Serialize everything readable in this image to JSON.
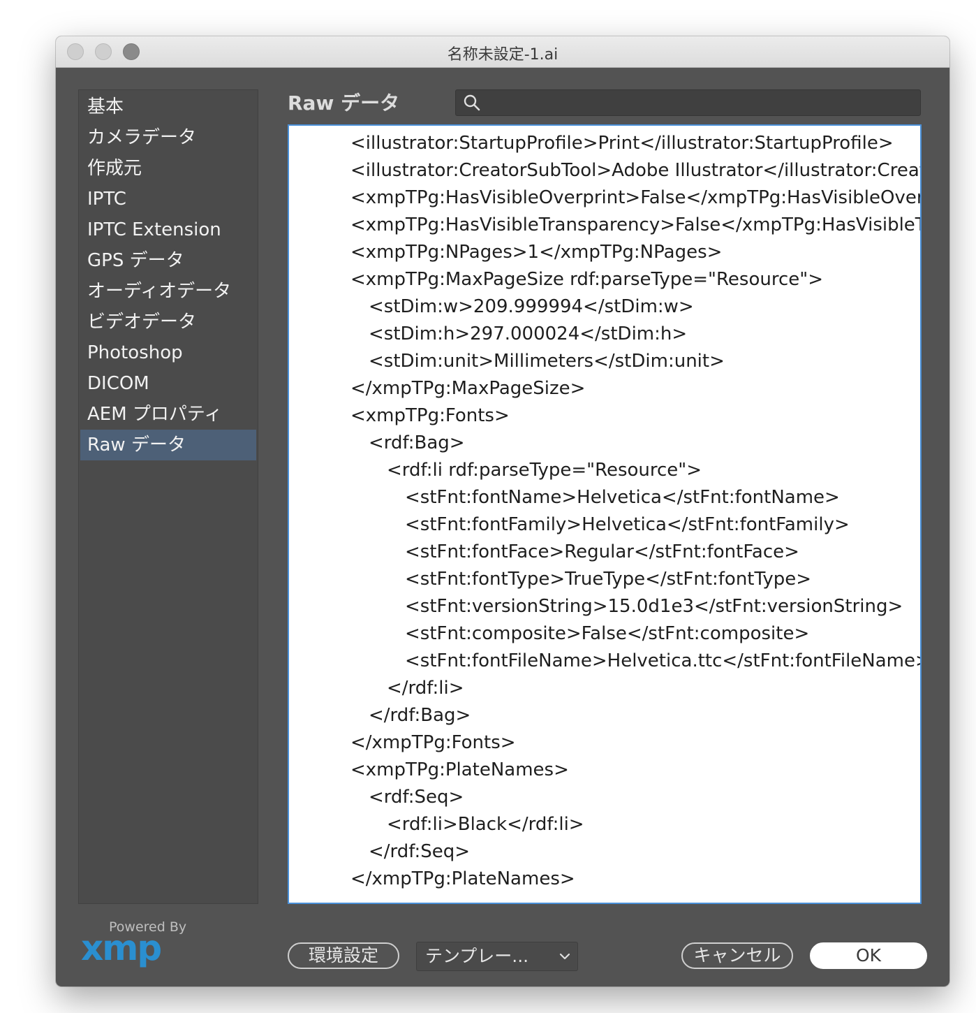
{
  "window": {
    "title": "名称未設定-1.ai"
  },
  "sidebar": {
    "items": [
      {
        "label": "基本"
      },
      {
        "label": "カメラデータ"
      },
      {
        "label": "作成元"
      },
      {
        "label": "IPTC"
      },
      {
        "label": "IPTC Extension"
      },
      {
        "label": "GPS データ"
      },
      {
        "label": "オーディオデータ"
      },
      {
        "label": "ビデオデータ"
      },
      {
        "label": "Photoshop"
      },
      {
        "label": "DICOM"
      },
      {
        "label": "AEM プロパティ"
      },
      {
        "label": "Raw データ",
        "selected": true
      }
    ]
  },
  "main": {
    "panel_title": "Raw データ",
    "search": {
      "value": "",
      "placeholder": ""
    },
    "raw_lines": [
      {
        "indent": 0,
        "text": "<illustrator:StartupProfile>Print</illustrator:StartupProfile>"
      },
      {
        "indent": 0,
        "text": "<illustrator:CreatorSubTool>Adobe Illustrator</illustrator:Creato"
      },
      {
        "indent": 0,
        "text": "<xmpTPg:HasVisibleOverprint>False</xmpTPg:HasVisibleOverpr"
      },
      {
        "indent": 0,
        "text": "<xmpTPg:HasVisibleTransparency>False</xmpTPg:HasVisibleTra"
      },
      {
        "indent": 0,
        "text": "<xmpTPg:NPages>1</xmpTPg:NPages>"
      },
      {
        "indent": 0,
        "text": "<xmpTPg:MaxPageSize rdf:parseType=\"Resource\">"
      },
      {
        "indent": 1,
        "text": "<stDim:w>209.999994</stDim:w>"
      },
      {
        "indent": 1,
        "text": "<stDim:h>297.000024</stDim:h>"
      },
      {
        "indent": 1,
        "text": "<stDim:unit>Millimeters</stDim:unit>"
      },
      {
        "indent": 0,
        "text": "</xmpTPg:MaxPageSize>"
      },
      {
        "indent": 0,
        "text": "<xmpTPg:Fonts>"
      },
      {
        "indent": 1,
        "text": "<rdf:Bag>"
      },
      {
        "indent": 2,
        "text": "<rdf:li rdf:parseType=\"Resource\">"
      },
      {
        "indent": 3,
        "text": "<stFnt:fontName>Helvetica</stFnt:fontName>"
      },
      {
        "indent": 3,
        "text": "<stFnt:fontFamily>Helvetica</stFnt:fontFamily>"
      },
      {
        "indent": 3,
        "text": "<stFnt:fontFace>Regular</stFnt:fontFace>"
      },
      {
        "indent": 3,
        "text": "<stFnt:fontType>TrueType</stFnt:fontType>"
      },
      {
        "indent": 3,
        "text": "<stFnt:versionString>15.0d1e3</stFnt:versionString>"
      },
      {
        "indent": 3,
        "text": "<stFnt:composite>False</stFnt:composite>"
      },
      {
        "indent": 3,
        "text": "<stFnt:fontFileName>Helvetica.ttc</stFnt:fontFileName>"
      },
      {
        "indent": 2,
        "text": "</rdf:li>"
      },
      {
        "indent": 1,
        "text": "</rdf:Bag>"
      },
      {
        "indent": 0,
        "text": "</xmpTPg:Fonts>"
      },
      {
        "indent": 0,
        "text": "<xmpTPg:PlateNames>"
      },
      {
        "indent": 1,
        "text": "<rdf:Seq>"
      },
      {
        "indent": 2,
        "text": "<rdf:li>Black</rdf:li>"
      },
      {
        "indent": 1,
        "text": "</rdf:Seq>"
      },
      {
        "indent": 0,
        "text": "</xmpTPg:PlateNames>"
      }
    ]
  },
  "footer": {
    "powered_by": "Powered By",
    "logo_text": "xmp",
    "preferences_label": "環境設定",
    "template_label": "テンプレー...",
    "cancel_label": "キャンセル",
    "ok_label": "OK"
  },
  "colors": {
    "window_bg": "#535353",
    "sidebar_bg": "#4b4b4b",
    "selection": "#4d6077",
    "focus_ring": "#4a90d9",
    "xmp_logo": "#2a8fd0"
  }
}
